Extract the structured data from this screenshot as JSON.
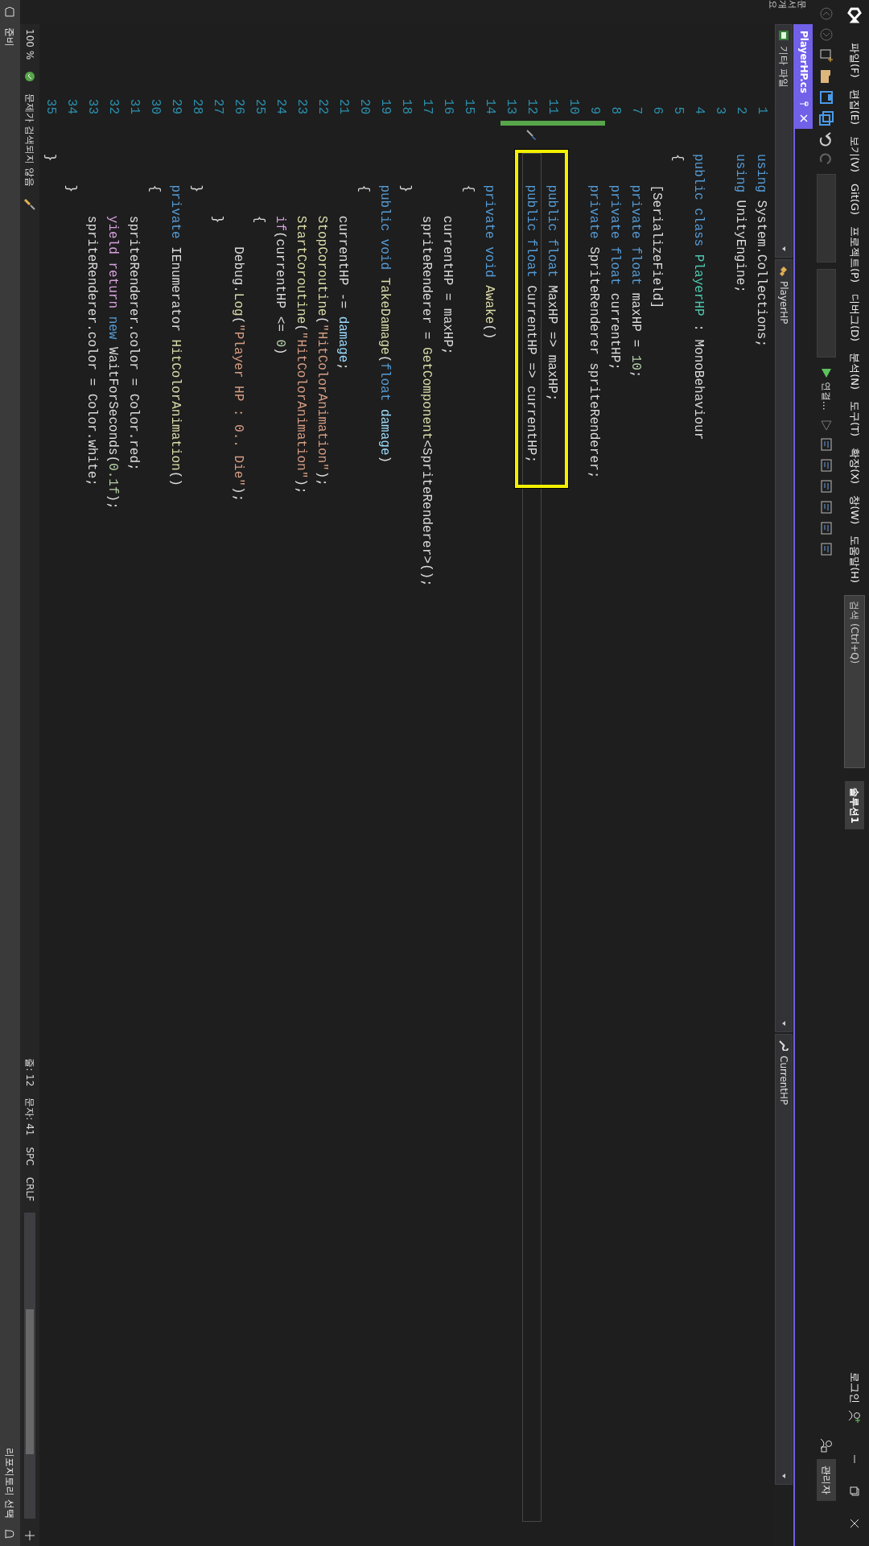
{
  "menu_bar": {
    "items": [
      "파일(F)",
      "편집(E)",
      "보기(V)",
      "Git(G)",
      "프로젝트(P)",
      "디버그(D)",
      "분석(N)",
      "도구(T)",
      "확장(X)",
      "창(W)",
      "도움말(H)"
    ],
    "search": {
      "placeholder": "검색 (Ctrl+Q)"
    },
    "solution": "솔루션1",
    "login": "로그인",
    "admin_badge": "관리자"
  },
  "toolbar": {
    "run_label": "연결..."
  },
  "side_tab": "문서 개요",
  "tabs": [
    {
      "label": "PlayerHP.cs",
      "selected": true
    }
  ],
  "nav_bar": {
    "project": "기타 파일",
    "type": "PlayerHP",
    "member": "CurrentHP"
  },
  "code_lines": [
    {
      "n": "1",
      "current": false,
      "changed": false,
      "tokens": [
        {
          "text": "using",
          "kind": "keyword"
        },
        {
          "text": " System.Collections;",
          "kind": "plain"
        }
      ]
    },
    {
      "n": "2",
      "current": false,
      "changed": false,
      "tokens": [
        {
          "text": "using",
          "kind": "keyword"
        },
        {
          "text": " UnityEngine;",
          "kind": "plain"
        }
      ]
    },
    {
      "n": "3",
      "current": false,
      "changed": false
    },
    {
      "n": "4",
      "current": false,
      "changed": false,
      "tokens": [
        {
          "text": "public class",
          "kind": "keyword"
        },
        {
          "text": " PlayerHP",
          "kind": "type"
        },
        {
          "text": " : MonoBehaviour",
          "kind": "plain"
        }
      ]
    },
    {
      "n": "5",
      "current": false,
      "changed": false,
      "tokens": [
        {
          "text": "{",
          "kind": "plain"
        }
      ]
    },
    {
      "n": "6",
      "current": false,
      "changed": false,
      "tokens": [
        {
          "text": "    [SerializeField]",
          "kind": "plain"
        }
      ]
    },
    {
      "n": "7",
      "current": false,
      "changed": false,
      "tokens": [
        {
          "text": "    private float",
          "kind": "keyword"
        },
        {
          "text": " maxHP = ",
          "kind": "plain"
        },
        {
          "text": "10",
          "kind": "number"
        },
        {
          "text": ";",
          "kind": "plain"
        }
      ]
    },
    {
      "n": "8",
      "current": false,
      "changed": false,
      "tokens": [
        {
          "text": "    private float",
          "kind": "keyword"
        },
        {
          "text": " currentHP;",
          "kind": "plain"
        }
      ]
    },
    {
      "n": "9",
      "current": false,
      "changed": true,
      "tokens": [
        {
          "text": "    private",
          "kind": "keyword"
        },
        {
          "text": " SpriteRenderer spriteRenderer;",
          "kind": "plain"
        }
      ]
    },
    {
      "n": "10",
      "current": false,
      "changed": true
    },
    {
      "n": "11",
      "current": false,
      "changed": true,
      "tokens": [
        {
          "text": "    public float",
          "kind": "keyword"
        },
        {
          "text": " MaxHP => maxHP;",
          "kind": "plain"
        }
      ]
    },
    {
      "n": "12",
      "current": true,
      "changed": true,
      "tokens": [
        {
          "text": "    public float",
          "kind": "keyword"
        },
        {
          "text": " CurrentHP => currentHP;",
          "kind": "plain"
        }
      ]
    },
    {
      "n": "13",
      "current": false,
      "changed": true
    },
    {
      "n": "14",
      "current": false,
      "changed": false,
      "tokens": [
        {
          "text": "    private void",
          "kind": "keyword"
        },
        {
          "text": " Awake",
          "kind": "method"
        },
        {
          "text": "()",
          "kind": "plain"
        }
      ]
    },
    {
      "n": "15",
      "current": false,
      "changed": false,
      "tokens": [
        {
          "text": "    {",
          "kind": "plain"
        }
      ]
    },
    {
      "n": "16",
      "current": false,
      "changed": false,
      "tokens": [
        {
          "text": "        currentHP = maxHP;",
          "kind": "plain"
        }
      ]
    },
    {
      "n": "17",
      "current": false,
      "changed": false,
      "tokens": [
        {
          "text": "        spriteRenderer = ",
          "kind": "plain"
        },
        {
          "text": "GetComponent",
          "kind": "method"
        },
        {
          "text": "<SpriteRenderer>();",
          "kind": "plain"
        }
      ]
    },
    {
      "n": "18",
      "current": false,
      "changed": false,
      "tokens": [
        {
          "text": "    }",
          "kind": "plain"
        }
      ]
    },
    {
      "n": "19",
      "current": false,
      "changed": false,
      "tokens": [
        {
          "text": "    public void",
          "kind": "keyword"
        },
        {
          "text": " TakeDamage",
          "kind": "method"
        },
        {
          "text": "(",
          "kind": "plain"
        },
        {
          "text": "float",
          "kind": "keyword"
        },
        {
          "text": " damage",
          "kind": "param"
        },
        {
          "text": ")",
          "kind": "plain"
        }
      ]
    },
    {
      "n": "20",
      "current": false,
      "changed": false,
      "tokens": [
        {
          "text": "    {",
          "kind": "plain"
        }
      ]
    },
    {
      "n": "21",
      "current": false,
      "changed": false,
      "tokens": [
        {
          "text": "        currentHP -= ",
          "kind": "plain"
        },
        {
          "text": "damage",
          "kind": "param"
        },
        {
          "text": ";",
          "kind": "plain"
        }
      ]
    },
    {
      "n": "22",
      "current": false,
      "changed": false,
      "tokens": [
        {
          "text": "        StopCoroutine",
          "kind": "method"
        },
        {
          "text": "(",
          "kind": "plain"
        },
        {
          "text": "\"HitColorAnimation\"",
          "kind": "string"
        },
        {
          "text": ");",
          "kind": "plain"
        }
      ]
    },
    {
      "n": "23",
      "current": false,
      "changed": false,
      "tokens": [
        {
          "text": "        StartCoroutine",
          "kind": "method"
        },
        {
          "text": "(",
          "kind": "plain"
        },
        {
          "text": "\"HitColorAnimation\"",
          "kind": "string"
        },
        {
          "text": ");",
          "kind": "plain"
        }
      ]
    },
    {
      "n": "24",
      "current": false,
      "changed": false,
      "tokens": [
        {
          "text": "        if",
          "kind": "control"
        },
        {
          "text": "(currentHP <= ",
          "kind": "plain"
        },
        {
          "text": "0",
          "kind": "number"
        },
        {
          "text": ")",
          "kind": "plain"
        }
      ]
    },
    {
      "n": "25",
      "current": false,
      "changed": false,
      "tokens": [
        {
          "text": "        {",
          "kind": "plain"
        }
      ]
    },
    {
      "n": "26",
      "current": false,
      "changed": false,
      "tokens": [
        {
          "text": "            Debug.",
          "kind": "plain"
        },
        {
          "text": "Log",
          "kind": "method"
        },
        {
          "text": "(",
          "kind": "plain"
        },
        {
          "text": "\"Player HP : 0.. Die\"",
          "kind": "string"
        },
        {
          "text": ");",
          "kind": "plain"
        }
      ]
    },
    {
      "n": "27",
      "current": false,
      "changed": false,
      "tokens": [
        {
          "text": "        }",
          "kind": "plain"
        }
      ]
    },
    {
      "n": "28",
      "current": false,
      "changed": false,
      "tokens": [
        {
          "text": "    }",
          "kind": "plain"
        }
      ]
    },
    {
      "n": "29",
      "current": false,
      "changed": false,
      "tokens": [
        {
          "text": "    private",
          "kind": "keyword"
        },
        {
          "text": " IEnumerator ",
          "kind": "plain"
        },
        {
          "text": "HitColorAnimation",
          "kind": "method"
        },
        {
          "text": "()",
          "kind": "plain"
        }
      ]
    },
    {
      "n": "30",
      "current": false,
      "changed": false,
      "tokens": [
        {
          "text": "    {",
          "kind": "plain"
        }
      ]
    },
    {
      "n": "31",
      "current": false,
      "changed": false,
      "tokens": [
        {
          "text": "        spriteRenderer.color = Color.red;",
          "kind": "plain"
        }
      ]
    },
    {
      "n": "32",
      "current": false,
      "changed": false,
      "tokens": [
        {
          "text": "        yield return",
          "kind": "control"
        },
        {
          "text": " new",
          "kind": "keyword"
        },
        {
          "text": " WaitForSeconds",
          "kind": "plain"
        },
        {
          "text": "(",
          "kind": "plain"
        },
        {
          "text": "0.1f",
          "kind": "number"
        },
        {
          "text": ");",
          "kind": "plain"
        }
      ]
    },
    {
      "n": "33",
      "current": false,
      "changed": false,
      "tokens": [
        {
          "text": "        spriteRenderer.color = Color.white;",
          "kind": "plain"
        }
      ]
    },
    {
      "n": "34",
      "current": false,
      "changed": false,
      "tokens": [
        {
          "text": "    }",
          "kind": "plain"
        }
      ]
    },
    {
      "n": "35",
      "current": false,
      "changed": false,
      "tokens": [
        {
          "text": "}",
          "kind": "plain"
        }
      ]
    }
  ],
  "editor_status": {
    "zoom": "100 %",
    "issues": "문제가 검색되지 않음",
    "line": "줄: 12",
    "column": "문자: 41",
    "whitespace": "SPC",
    "line_ending": "CRLF"
  },
  "status_bar": {
    "text": "준비",
    "repository": "리포지토리 선택"
  }
}
